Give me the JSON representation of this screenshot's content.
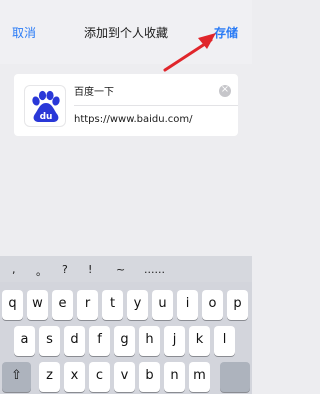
{
  "nav": {
    "cancel": "取消",
    "title": "添加到个人收藏",
    "save": "存储"
  },
  "bookmark": {
    "favicon": "baidu-paw-logo",
    "name_value": "百度一下",
    "url_value": "https://www.baidu.com/"
  },
  "keyboard": {
    "symbols": [
      ",",
      "。",
      "?",
      "!",
      "~",
      "......"
    ],
    "row1": [
      "q",
      "w",
      "e",
      "r",
      "t",
      "y",
      "u",
      "i",
      "o",
      "p"
    ],
    "row2": [
      "a",
      "s",
      "d",
      "f",
      "g",
      "h",
      "j",
      "k",
      "l"
    ],
    "row3": [
      "z",
      "x",
      "c",
      "v",
      "b",
      "n",
      "m"
    ],
    "shift_icon": "shift-icon"
  },
  "colors": {
    "accent": "#2b7cf6",
    "arrow": "#e0262b",
    "baidu_blue": "#2a38d8"
  }
}
